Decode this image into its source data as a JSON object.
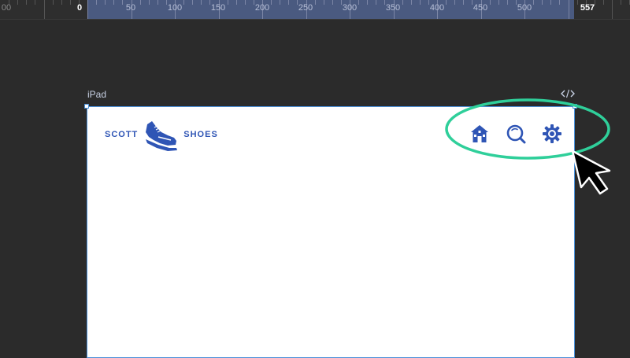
{
  "ruler": {
    "labels_left": [
      "00",
      "0"
    ],
    "labels": [
      "50",
      "100",
      "150",
      "200",
      "250",
      "300",
      "350",
      "400",
      "450",
      "500"
    ],
    "label_right": "557"
  },
  "device": {
    "name": "iPad",
    "code_icon": "code-brackets-icon"
  },
  "site": {
    "logo": {
      "left_text": "SCOTT",
      "right_text": "SHOES",
      "icon": "sneaker-icon"
    },
    "nav_icons": [
      "home-icon",
      "search-icon",
      "gear-icon"
    ]
  },
  "colors": {
    "brand_blue": "#2f55b5",
    "annotation_green": "#2fcf9a",
    "selection_blue": "#4a90d9",
    "ruler_highlight": "#4a5a80"
  }
}
